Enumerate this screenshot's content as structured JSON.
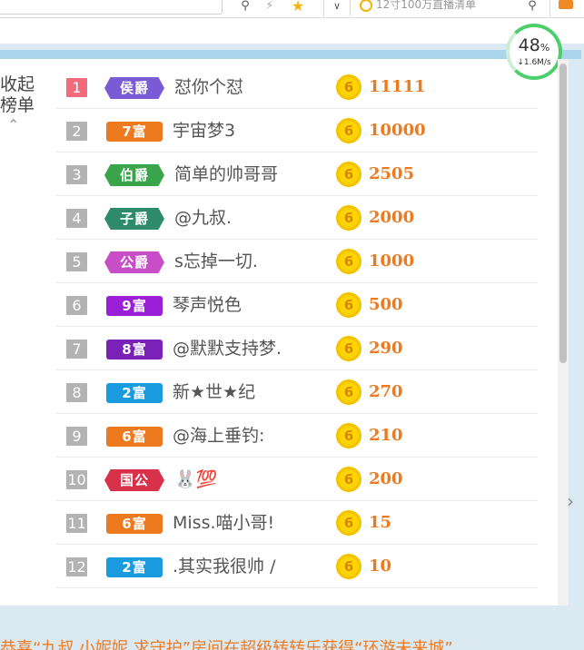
{
  "browser": {
    "search_placeholder": "12寸100万直播清单"
  },
  "speed": {
    "percent": "48",
    "percent_unit": "%",
    "rate": "↓1.6M/s"
  },
  "sidebar": {
    "collapse_label_line1": "收起",
    "collapse_label_line2": "榜单"
  },
  "ranks": [
    {
      "rank": "1",
      "badge": "侯爵",
      "badge_type": "noble",
      "badge_color": "#7a5bd6",
      "name": "怼你个怼",
      "score": "11111"
    },
    {
      "rank": "2",
      "badge": "7富",
      "badge_type": "wealth",
      "badge_color": "#ee7a1f",
      "name": "宇宙梦3",
      "score": "10000"
    },
    {
      "rank": "3",
      "badge": "伯爵",
      "badge_type": "noble",
      "badge_color": "#3aa44a",
      "name": "简单的帅哥哥",
      "score": "2505"
    },
    {
      "rank": "4",
      "badge": "子爵",
      "badge_type": "noble",
      "badge_color": "#2d8a6a",
      "name": "@九叔.",
      "score": "2000"
    },
    {
      "rank": "5",
      "badge": "公爵",
      "badge_type": "noble",
      "badge_color": "#c84ec8",
      "name": "s忘掉一切.",
      "score": "1000"
    },
    {
      "rank": "6",
      "badge": "9富",
      "badge_type": "wealth",
      "badge_color": "#9b1fd6",
      "name": "琴声悦色",
      "score": "500"
    },
    {
      "rank": "7",
      "badge": "8富",
      "badge_type": "wealth",
      "badge_color": "#7a22b8",
      "name": "@默默支持梦.",
      "score": "290"
    },
    {
      "rank": "8",
      "badge": "2富",
      "badge_type": "wealth",
      "badge_color": "#1a9be0",
      "name": "新★世★纪",
      "score": "270"
    },
    {
      "rank": "9",
      "badge": "6富",
      "badge_type": "wealth",
      "badge_color": "#ee7a1f",
      "name": "@海上垂钓:",
      "score": "210"
    },
    {
      "rank": "10",
      "badge": "国公",
      "badge_type": "noble",
      "badge_color": "#d8324a",
      "name": "🐰💯",
      "score": "200"
    },
    {
      "rank": "11",
      "badge": "6富",
      "badge_type": "wealth",
      "badge_color": "#ee7a1f",
      "name": "Miss.喵小哥!",
      "score": "15"
    },
    {
      "rank": "12",
      "badge": "2富",
      "badge_type": "wealth",
      "badge_color": "#1a9be0",
      "name": ".其实我很帅 /",
      "score": "10"
    }
  ],
  "coin_symbol": "6",
  "announcement": "恭喜“九叔 小妮妮 求守护”房间在超级转转乐获得“环游未来城”"
}
